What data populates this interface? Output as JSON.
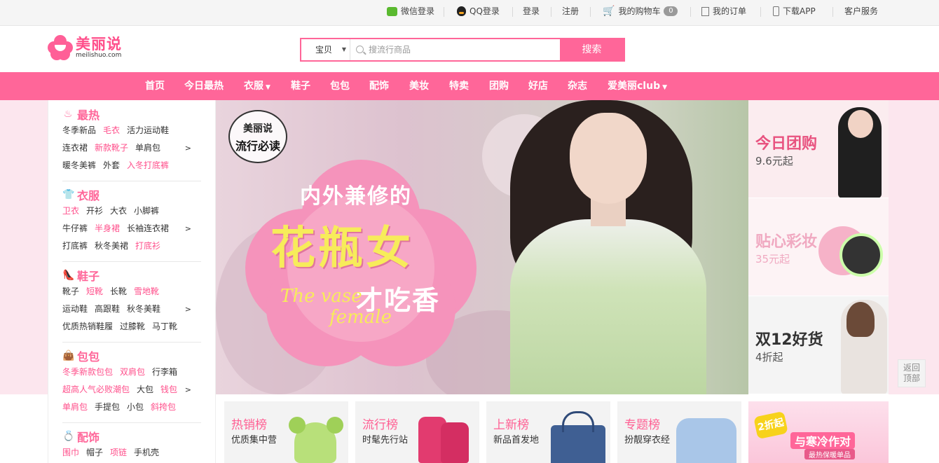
{
  "topbar": {
    "wechat_login": "微信登录",
    "qq_login": "QQ登录",
    "login": "登录",
    "register": "注册",
    "cart": "我的购物车",
    "cart_count": "0",
    "orders": "我的订单",
    "download_app": "下载APP",
    "customer_service": "客户服务"
  },
  "logo": {
    "cn": "美丽说",
    "en": "meilishuo.com"
  },
  "search": {
    "scope": "宝贝",
    "placeholder": "搜流行商品",
    "button": "搜索"
  },
  "nav": {
    "items": [
      "首页",
      "今日最热",
      "衣服",
      "鞋子",
      "包包",
      "配饰",
      "美妆",
      "特卖",
      "团购",
      "好店",
      "杂志",
      "爱美丽club"
    ]
  },
  "sidebar": {
    "categories": [
      {
        "title": "最热",
        "icon": "flame-icon",
        "rows": [
          [
            "冬季新品",
            "毛衣",
            "活力运动鞋"
          ],
          [
            "连衣裙",
            "新款靴子",
            "单肩包"
          ],
          [
            "暖冬美裤",
            "外套",
            "入冬打底裤"
          ]
        ]
      },
      {
        "title": "衣服",
        "icon": "shirt-icon",
        "rows": [
          [
            "卫衣",
            "开衫",
            "大衣",
            "小脚裤"
          ],
          [
            "牛仔裤",
            "半身裙",
            "长袖连衣裙"
          ],
          [
            "打底裤",
            "秋冬美裙",
            "打底衫"
          ]
        ]
      },
      {
        "title": "鞋子",
        "icon": "shoe-icon",
        "rows": [
          [
            "靴子",
            "短靴",
            "长靴",
            "雪地靴"
          ],
          [
            "运动鞋",
            "高跟鞋",
            "秋冬美鞋"
          ],
          [
            "优质热销鞋履",
            "过膝靴",
            "马丁靴"
          ]
        ]
      },
      {
        "title": "包包",
        "icon": "bag-icon",
        "rows": [
          [
            "冬季新款包包",
            "双肩包",
            "行李箱"
          ],
          [
            "超高人气必败潮包",
            "大包",
            "钱包"
          ],
          [
            "单肩包",
            "手提包",
            "小包",
            "斜挎包"
          ]
        ]
      },
      {
        "title": "配饰",
        "icon": "ring-icon",
        "rows": [
          [
            "围巾",
            "帽子",
            "项链",
            "手机壳"
          ]
        ]
      }
    ]
  },
  "hero": {
    "badge_top": "美丽说",
    "badge_bottom": "流行必读",
    "line1": "内外兼修的",
    "line2": "花瓶女",
    "line3": "才吃香",
    "en1": "The vase",
    "en2": "female"
  },
  "promos": [
    {
      "title": "今日团购",
      "sub": "9.6元起",
      "title_color": "#e8527f",
      "sub_color": "#555555"
    },
    {
      "title": "贴心彩妆",
      "sub": "35元起",
      "title_color": "#f0a9c1",
      "sub_color": "#f0a9c1"
    },
    {
      "title": "双12好货",
      "sub": "4折起",
      "title_color": "#333333",
      "sub_color": "#555555"
    }
  ],
  "back_to_top": {
    "line1": "返回",
    "line2": "顶部"
  },
  "cards": [
    {
      "title": "热销榜",
      "sub": "优质集中营"
    },
    {
      "title": "流行榜",
      "sub": "时髦先行站"
    },
    {
      "title": "上新榜",
      "sub": "新品首发地"
    },
    {
      "title": "专题榜",
      "sub": "扮靓穿衣经"
    }
  ],
  "winter_promo": {
    "tag": "2折起",
    "title": "与寒冷作对",
    "sub": "最热保暖单品"
  },
  "colors": {
    "brand_pink": "#ff6699",
    "hot_text": "#ff4f8b",
    "band_bg": "#fce6ee"
  }
}
